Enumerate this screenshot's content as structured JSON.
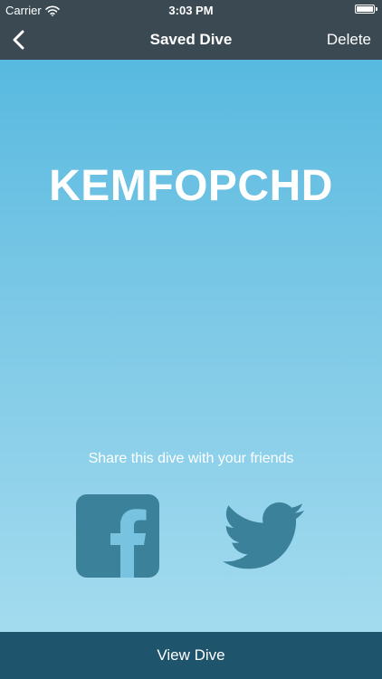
{
  "status_bar": {
    "carrier": "Carrier",
    "time": "3:03 PM",
    "wifi_icon": "wifi-icon",
    "battery_icon": "battery-icon"
  },
  "nav": {
    "back_icon": "chevron-left-icon",
    "title": "Saved Dive",
    "delete_label": "Delete"
  },
  "main": {
    "dive_code": "KEMFOPCHD",
    "share_text": "Share this dive with your friends",
    "share_buttons": [
      {
        "icon": "facebook-icon"
      },
      {
        "icon": "twitter-icon"
      }
    ]
  },
  "footer": {
    "view_dive_label": "View Dive"
  },
  "colors": {
    "nav_background": "#3a4952",
    "gradient_top": "#4fb6de",
    "gradient_bottom": "#a9def0",
    "icon_color": "#3a8199",
    "footer_background": "#1f546d",
    "text": "#ffffff"
  }
}
